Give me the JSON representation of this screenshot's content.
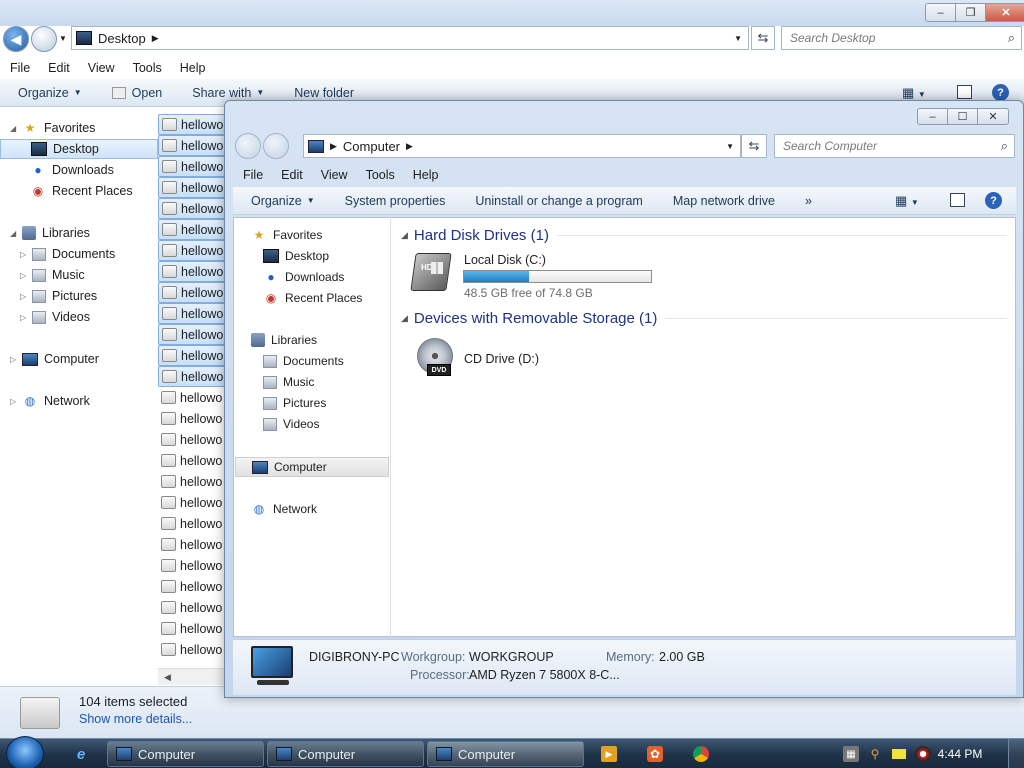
{
  "desktop_window": {
    "address": "Desktop",
    "search_placeholder": "Search Desktop",
    "menu": [
      "File",
      "Edit",
      "View",
      "Tools",
      "Help"
    ],
    "commands": {
      "organize": "Organize",
      "open": "Open",
      "share_with": "Share with",
      "new_folder": "New folder"
    },
    "nav": {
      "favorites": "Favorites",
      "desktop": "Desktop",
      "downloads": "Downloads",
      "recent_places": "Recent Places",
      "libraries": "Libraries",
      "documents": "Documents",
      "music": "Music",
      "pictures": "Pictures",
      "videos": "Videos",
      "computer": "Computer",
      "network": "Network"
    },
    "file_label": "hellowo",
    "status": {
      "items_selected": "104 items selected",
      "show_more": "Show more details..."
    }
  },
  "computer_window": {
    "address": "Computer",
    "search_placeholder": "Search Computer",
    "menu": [
      "File",
      "Edit",
      "View",
      "Tools",
      "Help"
    ],
    "commands": {
      "organize": "Organize",
      "system_properties": "System properties",
      "uninstall": "Uninstall or change a program",
      "map_drive": "Map network drive",
      "more": "»"
    },
    "nav": {
      "favorites": "Favorites",
      "desktop": "Desktop",
      "downloads": "Downloads",
      "recent_places": "Recent Places",
      "libraries": "Libraries",
      "documents": "Documents",
      "music": "Music",
      "pictures": "Pictures",
      "videos": "Videos",
      "computer": "Computer",
      "network": "Network"
    },
    "groups": {
      "hdd_heading": "Hard Disk Drives (1)",
      "removable_heading": "Devices with Removable Storage (1)"
    },
    "local_disk": {
      "name": "Local Disk (C:)",
      "free_text": "48.5 GB free of 74.8 GB",
      "used_fraction": 0.35
    },
    "cd_drive": {
      "name": "CD Drive (D:)",
      "badge": "DVD"
    },
    "hd_badge": "HD",
    "details": {
      "pc_name": "DIGIBRONY-PC",
      "workgroup_label": "Workgroup:",
      "workgroup": "WORKGROUP",
      "memory_label": "Memory:",
      "memory": "2.00 GB",
      "processor_label": "Processor:",
      "processor": "AMD Ryzen 7 5800X 8-C..."
    }
  },
  "taskbar": {
    "buttons": [
      "Computer",
      "Computer",
      "Computer"
    ],
    "clock": "4:44 PM"
  },
  "colors": {
    "accent": "#1e3287",
    "taskbar": "#1f3247",
    "capacity": "#1f7fc4"
  }
}
